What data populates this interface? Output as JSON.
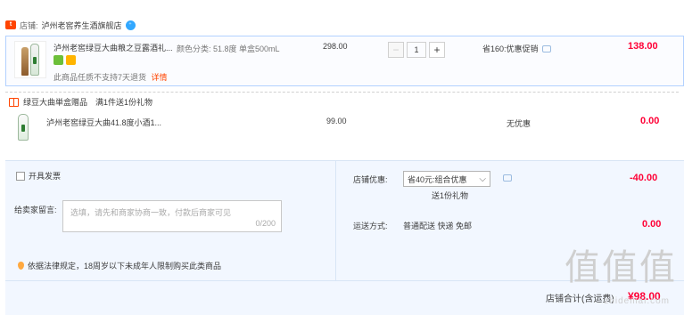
{
  "shop": {
    "badge": "tmall",
    "label": "店铺:",
    "name": "泸州老窖养生酒旗舰店",
    "chat_icon": "wangwang-icon"
  },
  "item1": {
    "title": "泸州老窖绿豆大曲粮之豆露酒礼...",
    "spec": "颜色分类: 51.8度 单盒500mL",
    "note": "此商品任质不支持7天退货",
    "note_link": "详情",
    "unit_price": "298.00",
    "qty": "1",
    "minus": "−",
    "plus": "+",
    "promo": "省160:优惠促销",
    "subtotal": "138.00"
  },
  "gift_header": {
    "label": "绿豆大曲単盒赠品",
    "rule": "满1件送1份礼物"
  },
  "item2": {
    "title": "泸州老窖绿豆大曲41.8度小酒1...",
    "unit_price": "99.00",
    "promo": "无优惠",
    "subtotal": "0.00"
  },
  "invoice": {
    "label": "开具发票"
  },
  "message": {
    "label": "给卖家留言:",
    "placeholder": "选填，请先和商家协商一致，付款后商家可见",
    "counter": "0/200"
  },
  "notice": {
    "text": "依据法律规定，18周岁以下未成年人限制购买此类商品"
  },
  "shop_discount": {
    "label": "店铺优惠:",
    "selected": "省40元:组合优惠",
    "gift_note": "送1份礼物",
    "amount": "-40.00"
  },
  "shipping": {
    "label": "运送方式:",
    "value": "普通配送 快递 免邮",
    "amount": "0.00"
  },
  "total": {
    "label": "店铺合计(含运费)",
    "amount": "¥98.00"
  },
  "watermark": {
    "big": "值值值",
    "small": "zhidemai.com"
  },
  "colors": {
    "accent": "#ff0036",
    "link": "#ff4400",
    "border": "#b2d1ff"
  }
}
